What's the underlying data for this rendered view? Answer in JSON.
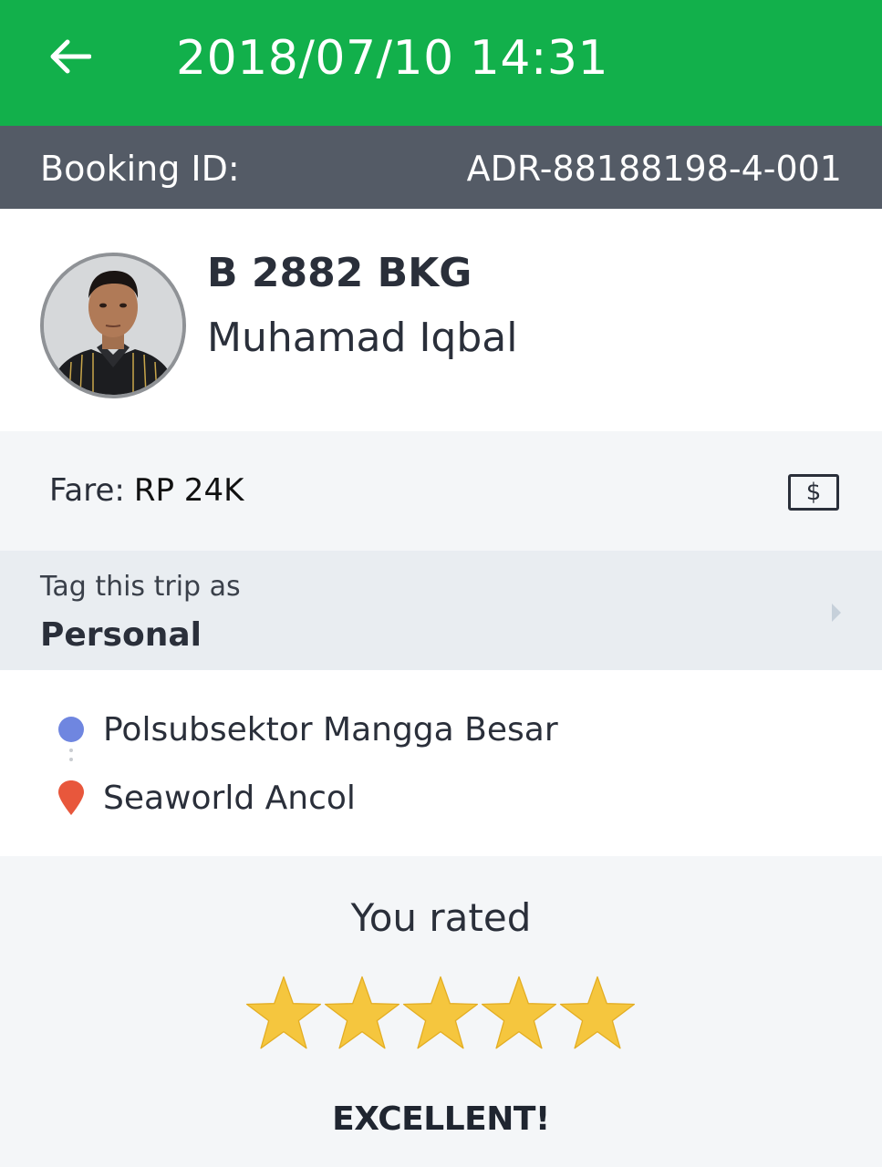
{
  "header": {
    "title": "2018/07/10 14:31",
    "back_icon": "arrow-left-icon",
    "background_color": "#12b04b"
  },
  "booking": {
    "label": "Booking ID:",
    "id": "ADR-88188198-4-001"
  },
  "driver": {
    "plate": "B 2882 BKG",
    "name": "Muhamad Iqbal",
    "avatar": "driver-photo"
  },
  "fare": {
    "label": "Fare:",
    "value": "RP 24K",
    "icon": "cash-icon",
    "icon_glyph": "$"
  },
  "tag": {
    "hint": "Tag this trip as",
    "value": "Personal",
    "icon": "chevron-right-icon"
  },
  "route": {
    "pickup": "Polsubsektor Mangga Besar",
    "destination": "Seaworld Ancol",
    "pickup_color": "#6f86e0",
    "destination_color": "#e8573c"
  },
  "rating": {
    "label": "You rated",
    "stars": 5,
    "max_stars": 5,
    "verdict": "EXCELLENT!",
    "star_color": "#f5c63e"
  }
}
